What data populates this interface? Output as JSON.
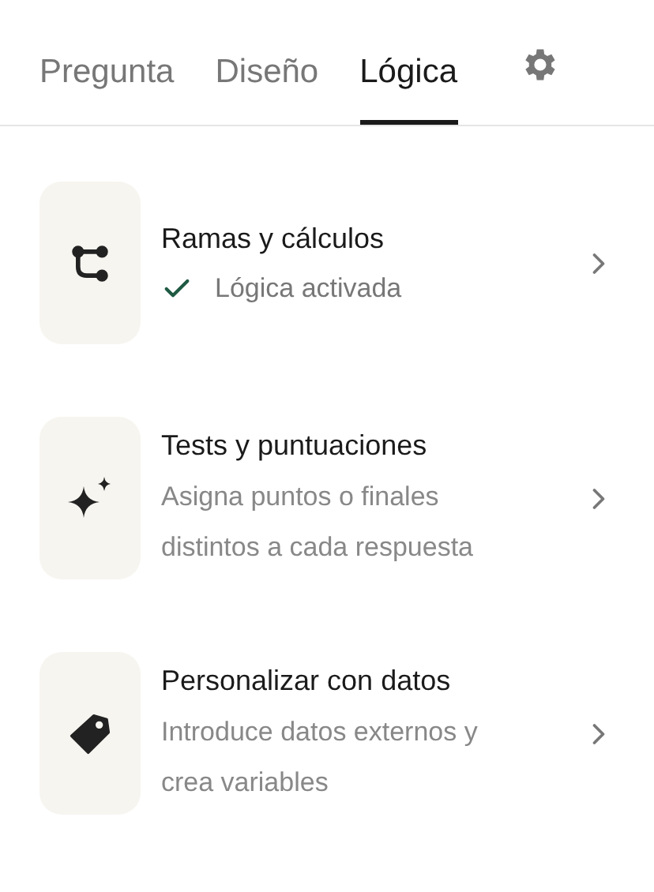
{
  "tabs": [
    {
      "label": "Pregunta",
      "selected": false
    },
    {
      "label": "Diseño",
      "selected": false
    },
    {
      "label": "Lógica",
      "selected": true
    }
  ],
  "items": [
    {
      "kind": "status",
      "title": "Ramas y cálculos",
      "status": "Lógica activada",
      "checked": true
    },
    {
      "kind": "description",
      "title": "Tests y puntuaciones",
      "lines": [
        "Asigna puntos o finales",
        "distintos a cada respuesta"
      ]
    },
    {
      "kind": "description",
      "title": "Personalizar con datos",
      "lines": [
        "Introduce datos externos y",
        "crea variables"
      ]
    }
  ]
}
